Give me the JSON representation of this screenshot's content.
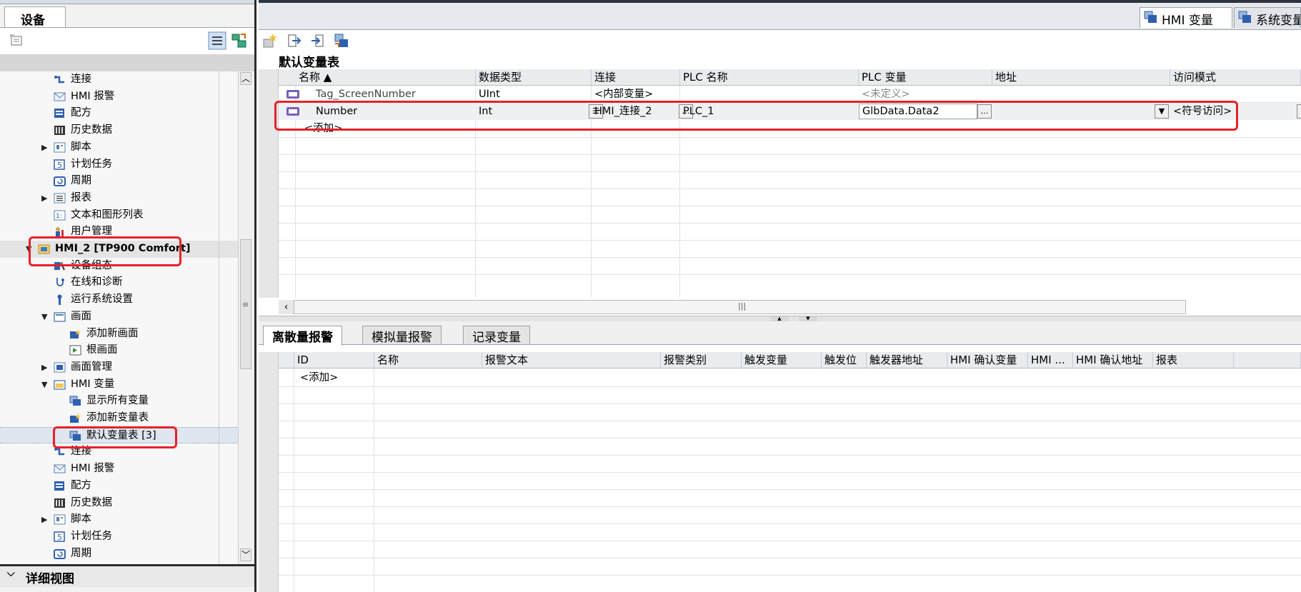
{
  "left_panel": {
    "tab_title": "设备",
    "tree": [
      {
        "label": "连接",
        "icon": "connection-icon",
        "level": 3
      },
      {
        "label": "HMI 报警",
        "icon": "alarm-mail-icon",
        "level": 3
      },
      {
        "label": "配方",
        "icon": "recipe-icon",
        "level": 3
      },
      {
        "label": "历史数据",
        "icon": "history-data-icon",
        "level": 3
      },
      {
        "label": "脚本",
        "icon": "script-icon",
        "level": 3,
        "expand": "collapsed"
      },
      {
        "label": "计划任务",
        "icon": "scheduler-icon",
        "level": 3
      },
      {
        "label": "周期",
        "icon": "cycle-icon",
        "level": 3
      },
      {
        "label": "报表",
        "icon": "report-icon",
        "level": 3,
        "expand": "collapsed"
      },
      {
        "label": "文本和图形列表",
        "icon": "text-graphic-list-icon",
        "level": 3
      },
      {
        "label": "用户管理",
        "icon": "user-admin-icon",
        "level": 3
      },
      {
        "label": "HMI_2 [TP900 Comfort]",
        "icon": "hmi-device-icon",
        "level": 2,
        "expand": "expanded",
        "bold": true,
        "highlight": true
      },
      {
        "label": "设备组态",
        "icon": "device-config-icon",
        "level": 3
      },
      {
        "label": "在线和诊断",
        "icon": "online-diagnostics-icon",
        "level": 3
      },
      {
        "label": "运行系统设置",
        "icon": "runtime-settings-icon",
        "level": 3
      },
      {
        "label": "画面",
        "icon": "screens-folder-icon",
        "level": 3,
        "expand": "expanded"
      },
      {
        "label": "添加新画面",
        "icon": "add-screen-icon",
        "level": 4
      },
      {
        "label": "根画面",
        "icon": "root-screen-icon",
        "level": 4
      },
      {
        "label": "画面管理",
        "icon": "screen-management-icon",
        "level": 3,
        "expand": "collapsed"
      },
      {
        "label": "HMI 变量",
        "icon": "hmi-tags-folder-icon",
        "level": 3,
        "expand": "expanded"
      },
      {
        "label": "显示所有变量",
        "icon": "show-all-tags-icon",
        "level": 4
      },
      {
        "label": "添加新变量表",
        "icon": "add-tag-table-icon",
        "level": 4
      },
      {
        "label": "默认变量表 [3]",
        "icon": "tag-table-icon",
        "level": 4,
        "selected": true
      },
      {
        "label": "连接",
        "icon": "connection-icon",
        "level": 3
      },
      {
        "label": "HMI 报警",
        "icon": "alarm-mail-icon",
        "level": 3
      },
      {
        "label": "配方",
        "icon": "recipe-icon",
        "level": 3
      },
      {
        "label": "历史数据",
        "icon": "history-data-icon",
        "level": 3
      },
      {
        "label": "脚本",
        "icon": "script-icon",
        "level": 3,
        "expand": "collapsed"
      },
      {
        "label": "计划任务",
        "icon": "scheduler-icon",
        "level": 3
      },
      {
        "label": "周期",
        "icon": "cycle-icon",
        "level": 3
      }
    ],
    "detail_view_label": "详细视图"
  },
  "right_tabs": {
    "hmi_tags": "HMI 变量",
    "system_tags": "系统变量"
  },
  "tag_table": {
    "title": "默认变量表",
    "columns": [
      "名称 ▲",
      "数据类型",
      "连接",
      "PLC 名称",
      "PLC 变量",
      "地址",
      "访问模式"
    ],
    "rows": [
      {
        "name": "Tag_ScreenNumber",
        "data_type": "UInt",
        "connection": "<内部变量>",
        "plc_name": "",
        "plc_tag": "<未定义>",
        "address": "",
        "access": ""
      },
      {
        "name": "Number",
        "data_type": "Int",
        "connection": "HMI_连接_2",
        "plc_name": "PLC_1",
        "plc_tag": "GlbData.Data2",
        "address": "",
        "access": "<符号访问>"
      }
    ],
    "add_label": "<添加>"
  },
  "bottom_tabs": [
    "离散量报警",
    "模拟量报警",
    "记录变量"
  ],
  "alarm_table": {
    "columns": [
      "ID",
      "名称",
      "报警文本",
      "报警类别",
      "触发变量",
      "触发位",
      "触发器地址",
      "HMI 确认变量",
      "HMI ...",
      "HMI 确认地址",
      "报表"
    ],
    "add_label": "<添加>"
  },
  "colors": {
    "highlight_box": "#e8202a",
    "selection_bg": "#dfe6ef",
    "header_bg": "#e9ecef"
  }
}
